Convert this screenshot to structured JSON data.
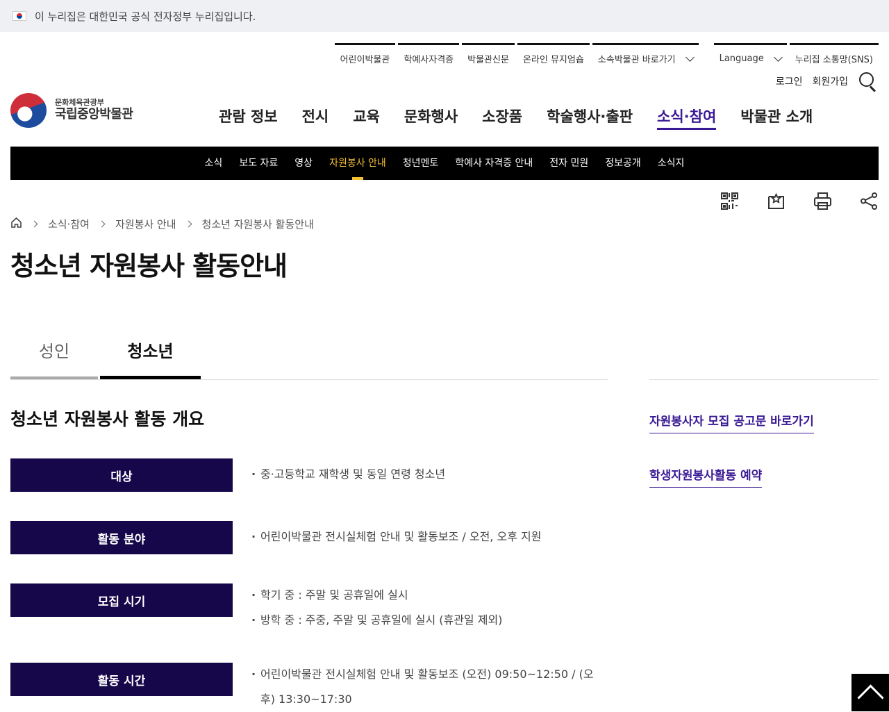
{
  "gov_banner": {
    "text": "이 누리집은 대한민국 공식 전자정부 누리집입니다."
  },
  "util": {
    "items": [
      "어린이박물관",
      "학예사자격증",
      "박물관신문",
      "온라인 뮤지엄숍",
      "소속박물관 바로가기"
    ],
    "language": "Language",
    "sns": "누리집 소통망(SNS)"
  },
  "auth": {
    "login": "로그인",
    "signup": "회원가입"
  },
  "logo": {
    "sub": "문화체육관광부",
    "main": "국립중앙박물관"
  },
  "gnb": [
    "관람 정보",
    "전시",
    "교육",
    "문화행사",
    "소장품",
    "학술행사·출판",
    "소식·참여",
    "박물관 소개"
  ],
  "gnb_active": "소식·참여",
  "sub_nav": [
    "소식",
    "보도 자료",
    "영상",
    "자원봉사 안내",
    "청년멘토",
    "학예사 자격증 안내",
    "전자 민원",
    "정보공개",
    "소식지"
  ],
  "sub_nav_active": "자원봉사 안내",
  "breadcrumb": [
    "소식·참여",
    "자원봉사 안내",
    "청소년 자원봉사 활동안내"
  ],
  "page_title": "청소년 자원봉사 활동안내",
  "tabs": {
    "adult": "성인",
    "youth": "청소년"
  },
  "side_links": [
    "자원봉사자 모집 공고문 바로가기",
    "학생자원봉사활동 예약"
  ],
  "section_title": "청소년 자원봉사 활동 개요",
  "info": [
    {
      "label": "대상",
      "values": [
        "중·고등학교 재학생 및 동일 연령 청소년"
      ]
    },
    {
      "label": "활동 분야",
      "values": [
        "어린이박물관 전시실체험 안내 및 활동보조 / 오전, 오후 지원"
      ]
    },
    {
      "label": "모집 시기",
      "values": [
        "학기 중 : 주말 및 공휴일에 실시",
        "방학 중 : 주중, 주말 및 공휴일에 실시 (휴관일 제외)"
      ]
    },
    {
      "label": "활동 시간",
      "values": [
        "어린이박물관 전시실체험 안내 및 활동보조 (오전) 09:50~12:50 / (오후) 13:30~17:30"
      ]
    }
  ],
  "colors": {
    "accent": "#3a1a94",
    "label_bg": "#16074a",
    "subnav_active": "#f5c033"
  }
}
